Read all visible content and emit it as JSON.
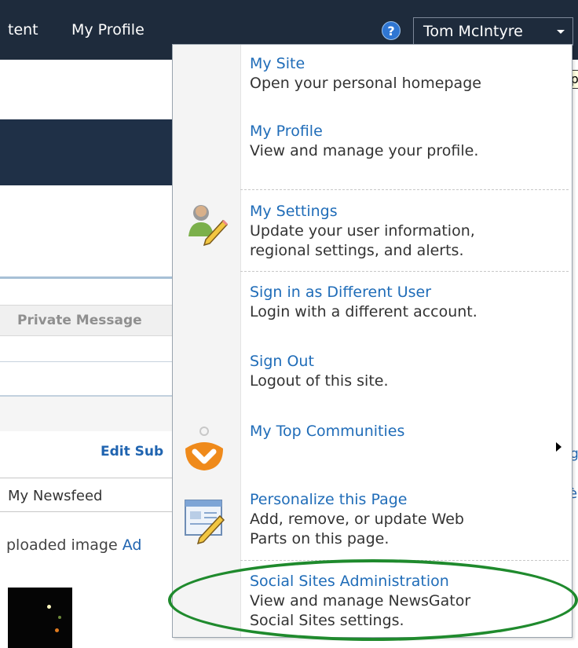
{
  "header": {
    "nav_items": [
      "tent",
      "My Profile"
    ],
    "help_glyph": "?",
    "user_name": "Tom McIntyre",
    "colors": {
      "bar": "#1e2b3c",
      "help": "#2f76d2"
    }
  },
  "tooltip": {
    "text": "Op"
  },
  "background_page": {
    "private_message": "Private Message",
    "edit_sub": "Edit Sub",
    "my_newsfeed": "My Newsfeed",
    "uploaded_prefix": "ploaded image ",
    "uploaded_link": "Ad",
    "right_link_a": "g",
    "right_link_b": "è"
  },
  "menu": {
    "items": [
      {
        "title": "My Site",
        "desc": [
          "Open your personal homepage"
        ]
      },
      {
        "title": "My Profile",
        "desc": [
          "View and manage your profile."
        ]
      },
      {
        "title": "My Settings",
        "desc": [
          "Update your user information,",
          "regional settings, and alerts."
        ],
        "icon": "user-settings-icon"
      },
      {
        "title": "Sign in as Different User",
        "desc": [
          "Login with a different account."
        ]
      },
      {
        "title": "Sign Out",
        "desc": [
          "Logout of this site."
        ]
      },
      {
        "title": "My Top Communities",
        "desc": [],
        "icon": "communities-icon",
        "has_submenu": true
      },
      {
        "title": "Personalize this Page",
        "desc": [
          "Add, remove, or update Web",
          "Parts on this page."
        ],
        "icon": "personalize-page-icon"
      },
      {
        "title": "Social Sites Administration",
        "desc": [
          "View and manage NewsGator",
          "Social Sites settings."
        ],
        "highlighted": true
      }
    ],
    "colors": {
      "link": "#1f6cb8",
      "highlight_ring": "#1f8a2d"
    }
  }
}
